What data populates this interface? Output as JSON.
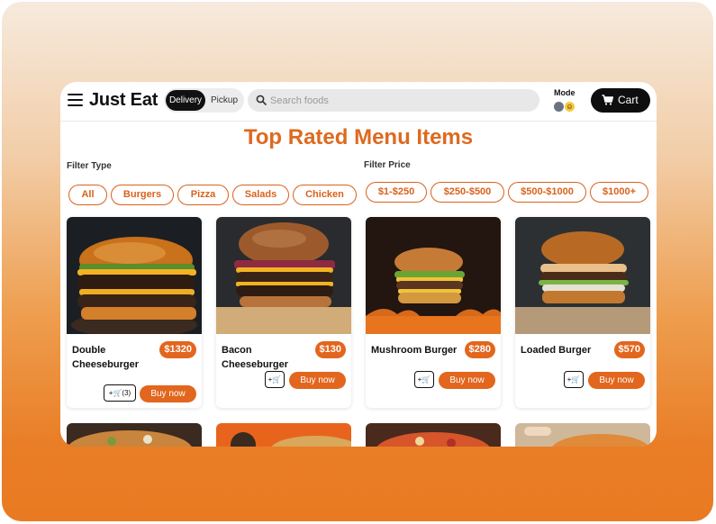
{
  "header": {
    "logo": "Just Eat",
    "service_options": [
      "Delivery",
      "Pickup"
    ],
    "search_placeholder": "Search foods",
    "mode_label": "Mode",
    "cart_label": "Cart"
  },
  "page_title": "Top Rated Menu Items",
  "filters": {
    "type_label": "Filter Type",
    "types": [
      "All",
      "Burgers",
      "Pizza",
      "Salads",
      "Chicken"
    ],
    "price_label": "Filter Price",
    "prices": [
      "$1-$250",
      "$250-$500",
      "$500-$1000",
      "$1000+"
    ]
  },
  "items": [
    {
      "name": "Double Cheeseburger",
      "price": "$1320",
      "qty_label": "(3)",
      "buy_label": "Buy now"
    },
    {
      "name": "Bacon Cheeseburger",
      "price": "$130",
      "qty_label": "",
      "buy_label": "Buy now"
    },
    {
      "name": "Mushroom Burger",
      "price": "$280",
      "qty_label": "",
      "buy_label": "Buy now"
    },
    {
      "name": "Loaded Burger",
      "price": "$570",
      "qty_label": "",
      "buy_label": "Buy now"
    }
  ],
  "colors": {
    "accent": "#e2661e",
    "title": "#dd6a1f",
    "dark": "#0e0e0e"
  }
}
